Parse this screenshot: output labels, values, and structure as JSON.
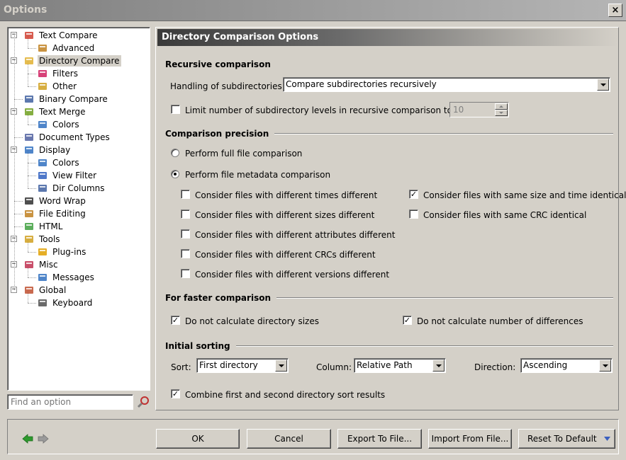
{
  "window": {
    "title": "Options",
    "close_glyph": "×"
  },
  "tree": {
    "items": [
      {
        "label": "Text Compare",
        "icon": "text-compare-icon",
        "level": 0,
        "expander": "−"
      },
      {
        "label": "Advanced",
        "icon": "wand-icon",
        "level": 1
      },
      {
        "label": "Directory Compare",
        "icon": "folders-icon",
        "level": 0,
        "expander": "−",
        "selected": true
      },
      {
        "label": "Filters",
        "icon": "filter-icon",
        "level": 1
      },
      {
        "label": "Other",
        "icon": "folder-gear-icon",
        "level": 1
      },
      {
        "label": "Binary Compare",
        "icon": "binary-icon",
        "level": 0
      },
      {
        "label": "Text Merge",
        "icon": "merge-icon",
        "level": 0,
        "expander": "−"
      },
      {
        "label": "Colors",
        "icon": "color-grid-icon",
        "level": 1
      },
      {
        "label": "Document Types",
        "icon": "document-types-icon",
        "level": 0
      },
      {
        "label": "Display",
        "icon": "monitor-icon",
        "level": 0,
        "expander": "−"
      },
      {
        "label": "Colors",
        "icon": "color-grid-icon",
        "level": 1
      },
      {
        "label": "View Filter",
        "icon": "filter-blue-icon",
        "level": 1
      },
      {
        "label": "Dir Columns",
        "icon": "columns-icon",
        "level": 1
      },
      {
        "label": "Word Wrap",
        "icon": "word-wrap-icon",
        "level": 0
      },
      {
        "label": "File Editing",
        "icon": "pencil-icon",
        "level": 0
      },
      {
        "label": "HTML",
        "icon": "html-icon",
        "level": 0
      },
      {
        "label": "Tools",
        "icon": "wrench-icon",
        "level": 0,
        "expander": "−"
      },
      {
        "label": "Plug-ins",
        "icon": "gear-icon",
        "level": 1
      },
      {
        "label": "Misc",
        "icon": "misc-icon",
        "level": 0,
        "expander": "−"
      },
      {
        "label": "Messages",
        "icon": "messages-icon",
        "level": 1
      },
      {
        "label": "Global",
        "icon": "global-icon",
        "level": 0,
        "expander": "−"
      },
      {
        "label": "Keyboard",
        "icon": "keyboard-icon",
        "level": 1
      }
    ]
  },
  "search": {
    "placeholder": "Find an option"
  },
  "panel": {
    "header": "Directory Comparison Options",
    "recursive": {
      "title": "Recursive comparison",
      "handling_label": "Handling of subdirectories:",
      "handling_value": "Compare subdirectories recursively",
      "limit_label": "Limit number of subdirectory levels in recursive comparison to",
      "limit_checked": false,
      "limit_value": "10"
    },
    "precision": {
      "title": "Comparison precision",
      "full_label": "Perform full file comparison",
      "full_selected": false,
      "metadata_label": "Perform file metadata comparison",
      "metadata_selected": true,
      "left_options": [
        {
          "label": "Consider files with different times different",
          "checked": false
        },
        {
          "label": "Consider files with different sizes different",
          "checked": false
        },
        {
          "label": "Consider files with different attributes different",
          "checked": false
        },
        {
          "label": "Consider files with different CRCs different",
          "checked": false
        },
        {
          "label": "Consider files with different versions different",
          "checked": false
        }
      ],
      "right_options": [
        {
          "label": "Consider files with same size and time identical",
          "checked": true
        },
        {
          "label": "Consider files with same CRC identical",
          "checked": false
        }
      ]
    },
    "faster": {
      "title": "For faster comparison",
      "no_dir_sizes": "Do not calculate directory sizes",
      "no_dir_sizes_checked": true,
      "no_diff_count": "Do not calculate number of differences",
      "no_diff_count_checked": true
    },
    "sorting": {
      "title": "Initial sorting",
      "sort_label": "Sort:",
      "sort_value": "First directory",
      "column_label": "Column:",
      "column_value": "Relative Path",
      "direction_label": "Direction:",
      "direction_value": "Ascending",
      "combine_label": "Combine first and second directory sort results",
      "combine_checked": true
    }
  },
  "buttons": {
    "ok": "OK",
    "cancel": "Cancel",
    "export": "Export To File...",
    "import": "Import From File...",
    "reset": "Reset To Default"
  },
  "colors": {
    "accent_green": "#2e9a2e",
    "header_dark": "#3a3a3a"
  }
}
